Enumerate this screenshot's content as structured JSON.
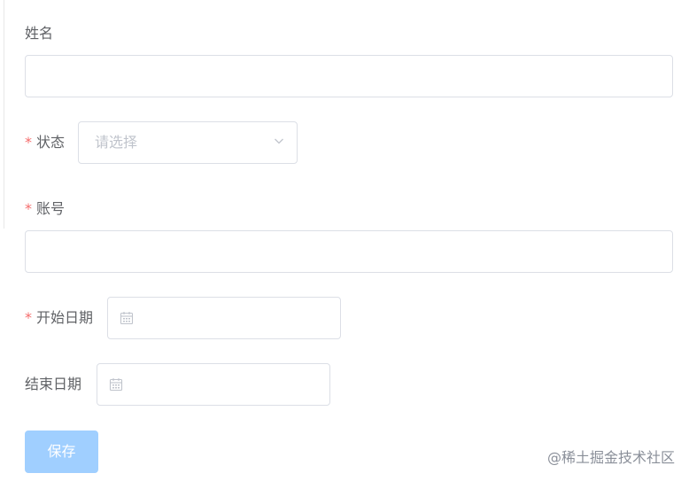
{
  "form": {
    "name": {
      "label": "姓名",
      "value": ""
    },
    "status": {
      "required_mark": "*",
      "label": "状态",
      "placeholder": "请选择",
      "value": ""
    },
    "account": {
      "required_mark": "*",
      "label": "账号",
      "value": ""
    },
    "start_date": {
      "required_mark": "*",
      "label": "开始日期",
      "value": ""
    },
    "end_date": {
      "label": "结束日期",
      "value": ""
    },
    "save_label": "保存"
  },
  "watermark": "@稀土掘金技术社区",
  "colors": {
    "required": "#f56c6c",
    "primary_disabled": "#a0cfff",
    "border": "#dcdfe6",
    "placeholder": "#c0c4cc"
  }
}
